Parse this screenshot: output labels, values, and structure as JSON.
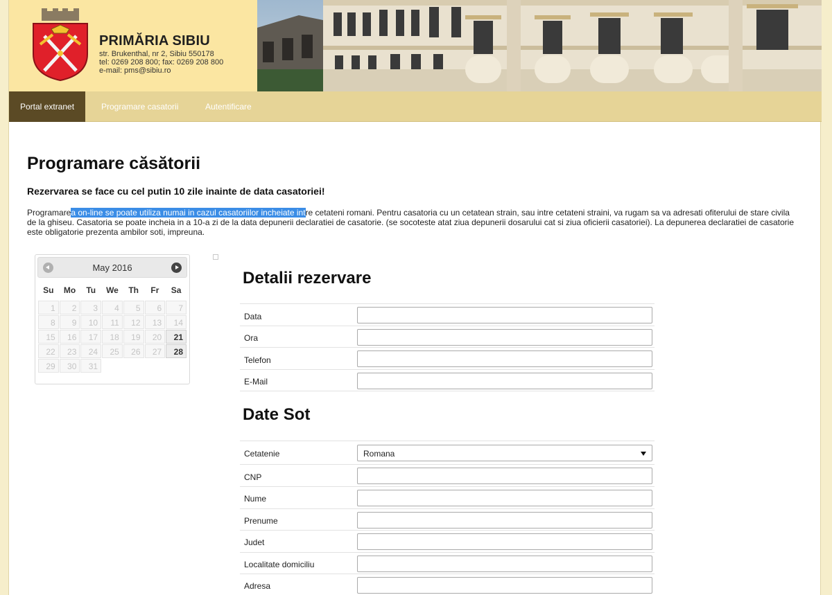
{
  "header": {
    "title": "PRIMĂRIA SIBIU",
    "address": "str. Brukenthal, nr 2, Sibiu 550178",
    "phone": "tel: 0269 208 800; fax: 0269 208 800",
    "email": "e-mail: pms@sibiu.ro"
  },
  "nav": {
    "items": [
      {
        "label": "Portal extranet"
      },
      {
        "label": "Programare casatorii"
      },
      {
        "label": "Autentificare"
      }
    ]
  },
  "main": {
    "title": "Programare căsătorii",
    "notice": "Rezervarea se face cu cel putin 10 zile inainte de data casatoriei!",
    "intro_before": "Programare",
    "intro_selected": "a on-line se poate utiliza numai in cazul casatoriilor incheiate int",
    "intro_after": "re cetateni romani. Pentru casatoria cu un cetatean strain, sau intre cetateni straini, va rugam sa va adresati ofiterului de stare civila de la ghiseu. Casatoria se poate incheia in a 10-a zi de la data depunerii declaratiei de casatorie. (se socoteste atat ziua depunerii dosarului cat si ziua oficierii casatoriei). La depunerea declaratiei de casatorie este obligatorie prezenta ambilor soti, impreuna."
  },
  "calendar": {
    "month": "May 2016",
    "weekdays": [
      "Su",
      "Mo",
      "Tu",
      "We",
      "Th",
      "Fr",
      "Sa"
    ],
    "weeks": [
      [
        {
          "d": "1"
        },
        {
          "d": "2"
        },
        {
          "d": "3"
        },
        {
          "d": "4"
        },
        {
          "d": "5"
        },
        {
          "d": "6"
        },
        {
          "d": "7"
        }
      ],
      [
        {
          "d": "8"
        },
        {
          "d": "9"
        },
        {
          "d": "10"
        },
        {
          "d": "11"
        },
        {
          "d": "12"
        },
        {
          "d": "13"
        },
        {
          "d": "14"
        }
      ],
      [
        {
          "d": "15"
        },
        {
          "d": "16"
        },
        {
          "d": "17"
        },
        {
          "d": "18"
        },
        {
          "d": "19"
        },
        {
          "d": "20"
        },
        {
          "d": "21",
          "available": true
        }
      ],
      [
        {
          "d": "22"
        },
        {
          "d": "23"
        },
        {
          "d": "24"
        },
        {
          "d": "25"
        },
        {
          "d": "26"
        },
        {
          "d": "27"
        },
        {
          "d": "28",
          "available": true
        }
      ],
      [
        {
          "d": "29"
        },
        {
          "d": "30"
        },
        {
          "d": "31"
        }
      ]
    ]
  },
  "reservation": {
    "title": "Detalii rezervare",
    "fields": [
      {
        "label": "Data",
        "value": ""
      },
      {
        "label": "Ora",
        "value": ""
      },
      {
        "label": "Telefon",
        "value": ""
      },
      {
        "label": "E-Mail",
        "value": ""
      }
    ]
  },
  "husband": {
    "title": "Date Sot",
    "citizenship_label": "Cetatenie",
    "citizenship_value": "Romana",
    "fields": [
      {
        "label": "CNP",
        "value": ""
      },
      {
        "label": "Nume",
        "value": ""
      },
      {
        "label": "Prenume",
        "value": ""
      },
      {
        "label": "Judet",
        "value": ""
      },
      {
        "label": "Localitate domiciliu",
        "value": ""
      },
      {
        "label": "Adresa",
        "value": ""
      }
    ]
  },
  "colors": {
    "header_bg": "#fbe6a2",
    "nav_bg": "#e6d497",
    "nav_active_bg": "#5b4a25",
    "selection": "#3b8de6",
    "crest_red": "#e0202a"
  }
}
